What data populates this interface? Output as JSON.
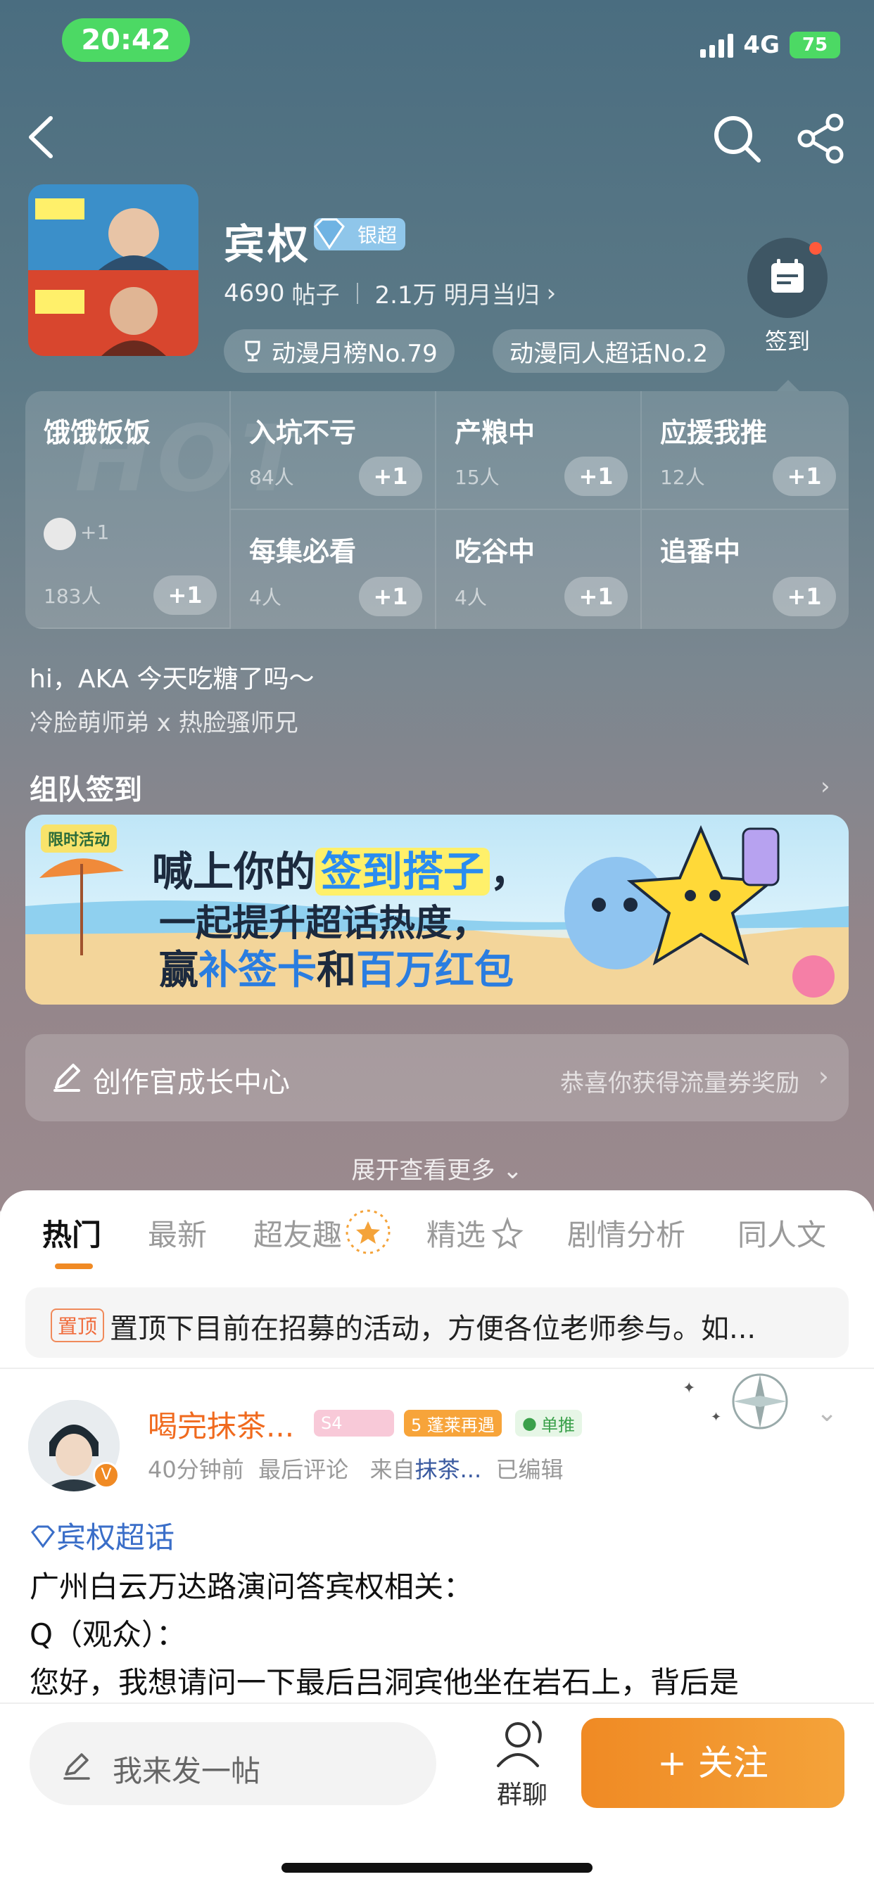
{
  "status": {
    "time": "20:42",
    "network": "4G",
    "battery": "75"
  },
  "header": {
    "title": "宾权",
    "badge": "银超",
    "posts_count": "4690",
    "posts_label": "帖子",
    "followers_count": "2.1万",
    "followers_label": "明月当归",
    "rank1": "动漫月榜No.79",
    "rank2": "动漫同人超话No.2",
    "checkin_label": "签到"
  },
  "grid": {
    "watermark": "HOT",
    "cells": [
      {
        "name": "饿饿饭饭",
        "count": "183人",
        "plus": "+1",
        "avatar_plus": "+1"
      },
      {
        "name": "入坑不亏",
        "count": "84人",
        "plus": "+1"
      },
      {
        "name": "产粮中",
        "count": "15人",
        "plus": "+1"
      },
      {
        "name": "应援我推",
        "count": "12人",
        "plus": "+1"
      },
      {
        "name": "每集必看",
        "count": "4人",
        "plus": "+1"
      },
      {
        "name": "吃谷中",
        "count": "4人",
        "plus": "+1"
      },
      {
        "name": "追番中",
        "count": "",
        "plus": "+1"
      }
    ]
  },
  "intro": {
    "greeting": "hi，AKA 今天吃糖了吗～",
    "sub": "冷脸萌师弟 x 热脸骚师兄"
  },
  "team_checkin": {
    "title": "组队签到",
    "arrow": "›"
  },
  "banner": {
    "tag": "限时活动",
    "line1_a": "喊上你的",
    "line1_hl": "签到搭子",
    "line1_b": "，",
    "line2": "一起提升超话热度，",
    "line3_a": "赢",
    "line3_b": "补签卡",
    "line3_c": "和",
    "line3_d": "百万红包"
  },
  "creator": {
    "label": "创作官成长中心",
    "right": "恭喜你获得流量券奖励",
    "chevron": "›"
  },
  "expand": "展开查看更多 ⌄",
  "tabs": [
    "热门",
    "最新",
    "超友趣",
    "精选",
    "剧情分析",
    "同人文"
  ],
  "pinned": {
    "tag": "置顶",
    "text": "置顶下目前在招募的活动，方便各位老师参与。如..."
  },
  "post": {
    "author": "喝完抹茶...",
    "level": "S4",
    "badge1": "5 蓬莱再遇",
    "badge2": "单推",
    "time": "40分钟前",
    "last_comment": "最后评论",
    "from_label": "来自",
    "source": "抹茶...",
    "edited": "已编辑",
    "topic": "宾权超话",
    "lines": [
      " 广州白云万达路演问答宾权相关：",
      "Q（观众）：",
      "您好，我想请问一下最后吕洞宾他坐在岩石上，背后是"
    ]
  },
  "bottom": {
    "compose": "我来发一帖",
    "group": "群聊",
    "follow": "+ 关注"
  }
}
